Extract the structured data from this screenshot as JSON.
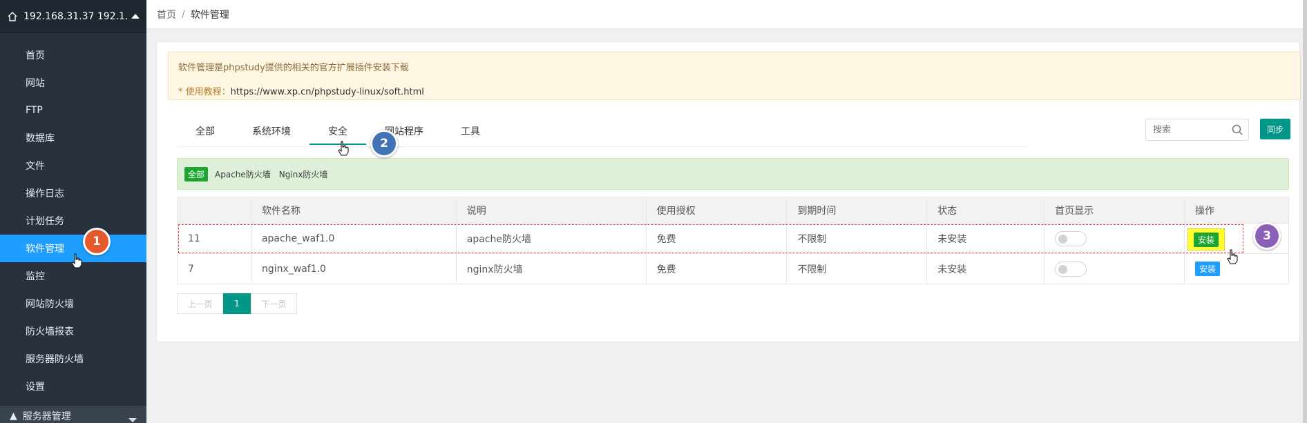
{
  "sidebar": {
    "server": "192.168.31.37 192.1...",
    "items": [
      {
        "label": "首页"
      },
      {
        "label": "网站"
      },
      {
        "label": "FTP"
      },
      {
        "label": "数据库"
      },
      {
        "label": "文件"
      },
      {
        "label": "操作日志"
      },
      {
        "label": "计划任务"
      },
      {
        "label": "软件管理",
        "active": true
      },
      {
        "label": "监控"
      },
      {
        "label": "网站防火墙"
      },
      {
        "label": "防火墙报表"
      },
      {
        "label": "服务器防火墙"
      },
      {
        "label": "设置"
      }
    ],
    "bottom_label": "服务器管理"
  },
  "breadcrumb": {
    "home": "首页",
    "separator": "/",
    "current": "软件管理"
  },
  "notice": {
    "line1": "软件管理是phpstudy提供的相关的官方扩展插件安装下载",
    "line2_label": "* 使用教程：",
    "line2_url": "https://www.xp.cn/phpstudy-linux/soft.html"
  },
  "tabs": [
    {
      "label": "全部"
    },
    {
      "label": "系统环境"
    },
    {
      "label": "安全",
      "active": true
    },
    {
      "label": "网站程序"
    },
    {
      "label": "工具"
    }
  ],
  "search": {
    "placeholder": "搜索"
  },
  "sync_label": "同步",
  "filter": {
    "all": "全部",
    "items": [
      "Apache防火墙",
      "Nginx防火墙"
    ]
  },
  "table": {
    "headers": [
      "",
      "软件名称",
      "说明",
      "使用授权",
      "到期时间",
      "状态",
      "首页显示",
      "操作"
    ],
    "rows": [
      {
        "id": "11",
        "name": "apache_waf1.0",
        "desc": "apache防火墙",
        "license": "免费",
        "expire": "不限制",
        "status": "未安装",
        "homepage_display": false,
        "action": "安装"
      },
      {
        "id": "7",
        "name": "nginx_waf1.0",
        "desc": "nginx防火墙",
        "license": "免费",
        "expire": "不限制",
        "status": "未安装",
        "homepage_display": false,
        "action": "安装"
      }
    ]
  },
  "pagination": {
    "prev": "上一页",
    "current": "1",
    "next": "下一页"
  },
  "callouts": [
    "1",
    "2",
    "3"
  ],
  "colors": {
    "sidebar_bg": "#28313d",
    "active_blue": "#1e9fff",
    "teal": "#009688",
    "green": "#1ea52f"
  }
}
